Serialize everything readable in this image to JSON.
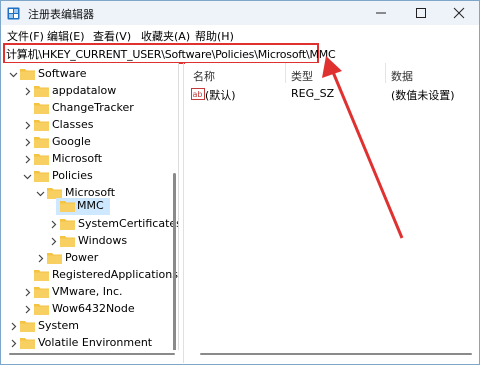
{
  "window": {
    "title": "注册表编辑器",
    "controls": {
      "minimize": "minimize",
      "maximize": "maximize",
      "close": "close"
    }
  },
  "menu": [
    "文件(F)",
    "编辑(E)",
    "查看(V)",
    "收藏夹(A)",
    "帮助(H)"
  ],
  "address": {
    "path": "计算机\\HKEY_CURRENT_USER\\Software\\Policies\\Microsoft\\MMC"
  },
  "tree": [
    {
      "label": "Software",
      "expanded": true
    },
    {
      "label": "appdatalow"
    },
    {
      "label": "ChangeTracker"
    },
    {
      "label": "Classes"
    },
    {
      "label": "Google"
    },
    {
      "label": "Microsoft"
    },
    {
      "label": "Policies",
      "expanded": true
    },
    {
      "label": "Microsoft",
      "expanded": true
    },
    {
      "label": "MMC",
      "selected": true
    },
    {
      "label": "SystemCertificates"
    },
    {
      "label": "Windows"
    },
    {
      "label": "Power"
    },
    {
      "label": "RegisteredApplications"
    },
    {
      "label": "VMware, Inc."
    },
    {
      "label": "Wow6432Node"
    },
    {
      "label": "System"
    },
    {
      "label": "Volatile Environment"
    }
  ],
  "list": {
    "columns": {
      "name": "名称",
      "type": "类型",
      "data": "数据"
    },
    "rows": [
      {
        "name": "(默认)",
        "type": "REG_SZ",
        "data": "(数值未设置)",
        "icon": "string-value-icon"
      }
    ]
  },
  "colors": {
    "highlight": "#e03131",
    "selection": "#cde8ff",
    "folder": "#f5c342"
  }
}
